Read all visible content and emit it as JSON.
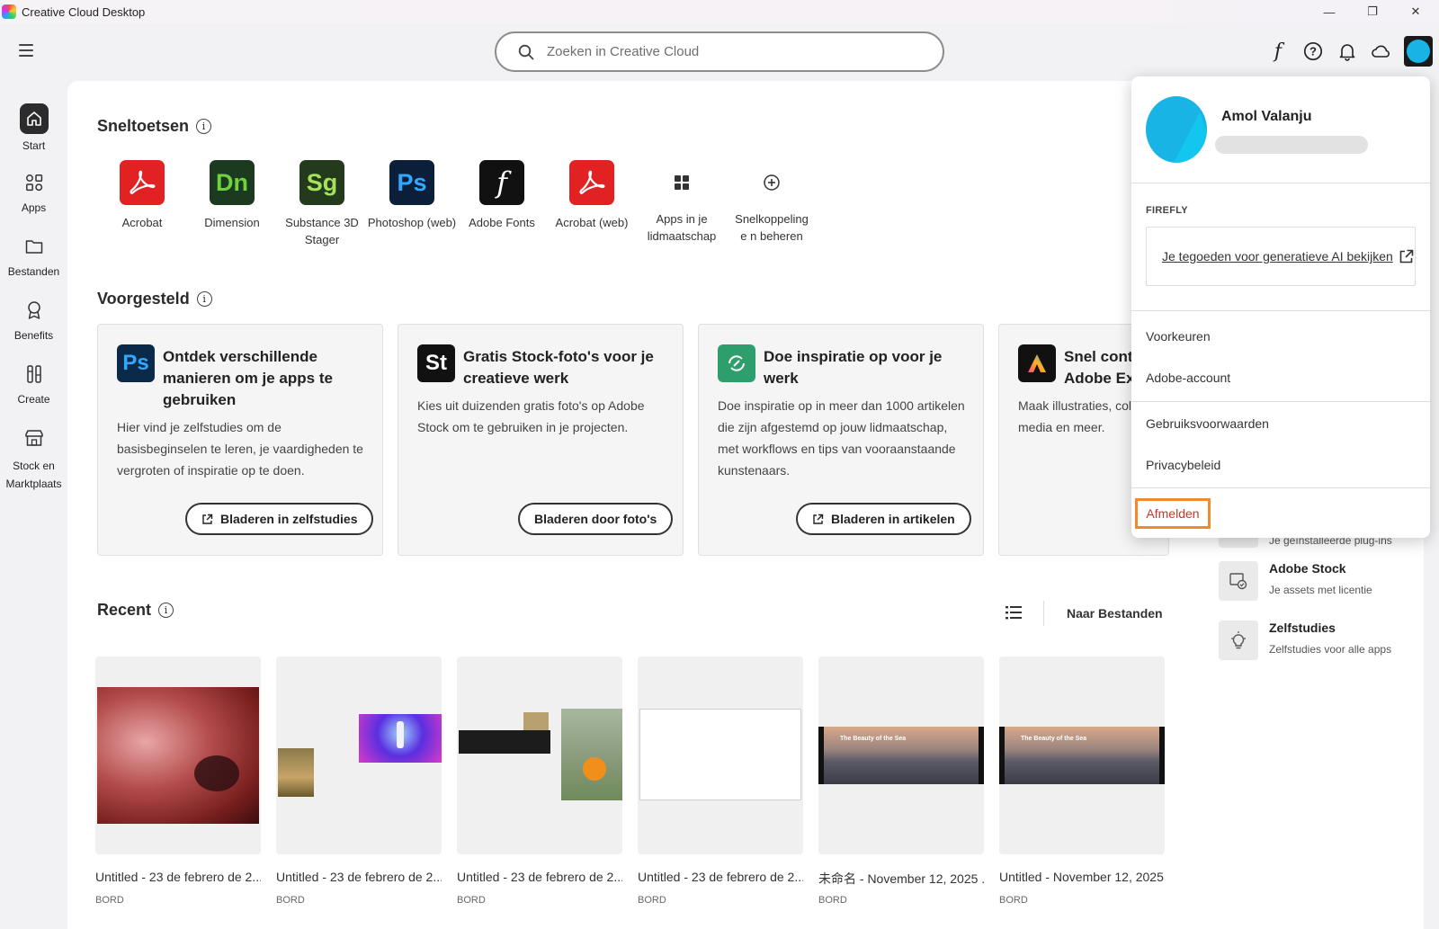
{
  "window": {
    "title": "Creative Cloud Desktop",
    "minimize": "—",
    "restore": "❐",
    "close": "✕"
  },
  "search": {
    "placeholder": "Zoeken in Creative Cloud"
  },
  "nav": [
    {
      "label": "Start"
    },
    {
      "label": "Apps"
    },
    {
      "label": "Bestanden"
    },
    {
      "label": "Benefits"
    },
    {
      "label": "Create"
    },
    {
      "label": "Stock en Marktplaats"
    }
  ],
  "shortcuts": {
    "title": "Sneltoetsen",
    "items": [
      {
        "label": "Acrobat",
        "glyph": "",
        "color": "#e22222",
        "fg": "#fff"
      },
      {
        "label": "Dimension",
        "glyph": "Dn",
        "color": "#1c3a1f",
        "fg": "#6ed33e"
      },
      {
        "label": "Substance 3D Stager",
        "glyph": "Sg",
        "color": "#233b1c",
        "fg": "#a6e35a"
      },
      {
        "label": "Photoshop (web)",
        "glyph": "Ps",
        "color": "#0b1f3a",
        "fg": "#31a8ff"
      },
      {
        "label": "Adobe Fonts",
        "glyph": "f",
        "color": "#111",
        "fg": "#fff"
      },
      {
        "label": "Acrobat (web)",
        "glyph": "",
        "color": "#e22222",
        "fg": "#fff"
      },
      {
        "label": "Apps in je lidmaatschap"
      },
      {
        "label": "Snelkoppelinge n beheren"
      }
    ]
  },
  "suggested": {
    "title": "Voorgesteld",
    "cards": [
      {
        "icon": "Ps",
        "icon_bg": "#0b2a4a",
        "icon_fg": "#31a8ff",
        "title": "Ontdek verschillende manieren om je apps te gebruiken",
        "body": "Hier vind je zelfstudies om de basisbeginselen te leren, je vaardigheden te vergroten of inspiratie op te doen.",
        "button": "Bladeren in zelfstudies"
      },
      {
        "icon": "St",
        "icon_bg": "#111",
        "icon_fg": "#fff",
        "title": "Gratis Stock-foto's voor je creatieve werk",
        "body": "Kies uit duizenden gratis foto's op Adobe Stock om te gebruiken in je projecten.",
        "button": "Bladeren door foto's"
      },
      {
        "icon": "",
        "icon_bg": "#2e9e6c",
        "icon_fg": "#fff",
        "title": "Doe inspiratie op voor je werk",
        "body": "Doe inspiratie op in meer dan 1000 artikelen die zijn afgestemd op jouw lidmaatschap, met workflows en tips van vooraanstaande kunstenaars.",
        "button": "Bladeren in artikelen"
      },
      {
        "icon": "A",
        "icon_bg": "#111",
        "icon_fg": "#fff",
        "title": "Snel conten Adobe Exp",
        "body": "Maak illustraties, colla media en meer.",
        "button": ""
      }
    ]
  },
  "recent": {
    "title": "Recent",
    "to_files": "Naar Bestanden",
    "items": [
      {
        "name": "Untitled - 23 de febrero de 2...",
        "type": "BORD"
      },
      {
        "name": "Untitled - 23 de febrero de 2...",
        "type": "BORD"
      },
      {
        "name": "Untitled - 23 de febrero de 2...",
        "type": "BORD"
      },
      {
        "name": "Untitled - 23 de febrero de 2...",
        "type": "BORD"
      },
      {
        "name": "未命名 - November 12, 2025 ...",
        "type": "BORD"
      },
      {
        "name": "Untitled - November 12, 2025...",
        "type": "BORD"
      }
    ],
    "thumb_caption": "The Beauty of the Sea"
  },
  "right_panel": [
    {
      "title": "",
      "sub": "Je geïnstalleerde plug-ins"
    },
    {
      "title": "Adobe Stock",
      "sub": "Je assets met licentie"
    },
    {
      "title": "Zelfstudies",
      "sub": "Zelfstudies voor alle apps"
    }
  ],
  "account_menu": {
    "name": "Amol Valanju",
    "section_label": "FIREFLY",
    "firefly_link": "Je tegoeden voor generatieve AI bekijken",
    "items": [
      "Voorkeuren",
      "Adobe-account",
      "Gebruiksvoorwaarden",
      "Privacybeleid"
    ],
    "sign_out": "Afmelden"
  }
}
